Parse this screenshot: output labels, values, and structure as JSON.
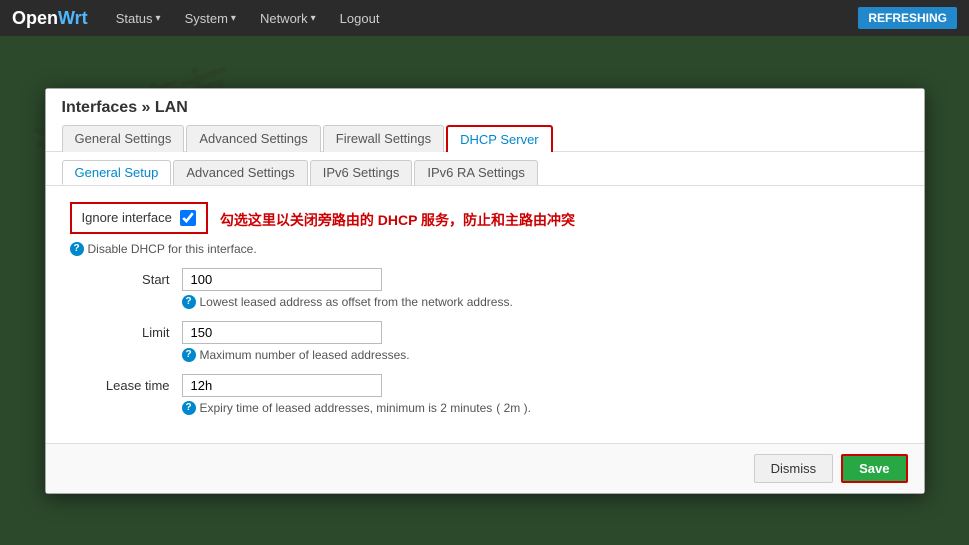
{
  "navbar": {
    "brand": "OpenWrt",
    "brand_open": "Open",
    "brand_wrt": "Wrt",
    "items": [
      {
        "label": "Status",
        "arrow": "▾"
      },
      {
        "label": "System",
        "arrow": "▾"
      },
      {
        "label": "Network",
        "arrow": "▾"
      },
      {
        "label": "Logout",
        "arrow": ""
      }
    ],
    "refresh_label": "REFRESHING"
  },
  "modal": {
    "title": "Interfaces » LAN",
    "tabs": [
      {
        "label": "General Settings",
        "active": false,
        "highlighted": false
      },
      {
        "label": "Advanced Settings",
        "active": false,
        "highlighted": false
      },
      {
        "label": "Firewall Settings",
        "active": false,
        "highlighted": false
      },
      {
        "label": "DHCP Server",
        "active": true,
        "highlighted": true
      }
    ],
    "sub_tabs": [
      {
        "label": "General Setup",
        "active": true
      },
      {
        "label": "Advanced Settings",
        "active": false
      },
      {
        "label": "IPv6 Settings",
        "active": false
      },
      {
        "label": "IPv6 RA Settings",
        "active": false
      }
    ],
    "form": {
      "ignore_interface_label": "Ignore interface",
      "ignore_checked": true,
      "annotation": "勾选这里以关闭旁路由的 DHCP 服务，防止和主路由冲突",
      "disable_dhcp_help": "Disable DHCP for this interface.",
      "start_label": "Start",
      "start_value": "100",
      "start_help": "Lowest leased address as offset from the network address.",
      "limit_label": "Limit",
      "limit_value": "150",
      "limit_help": "Maximum number of leased addresses.",
      "lease_label": "Lease time",
      "lease_value": "12h",
      "lease_help": "Expiry time of leased addresses, minimum is 2 minutes",
      "lease_help_suffix": "( 2m )."
    },
    "footer": {
      "dismiss_label": "Dismiss",
      "save_label": "Save"
    }
  }
}
